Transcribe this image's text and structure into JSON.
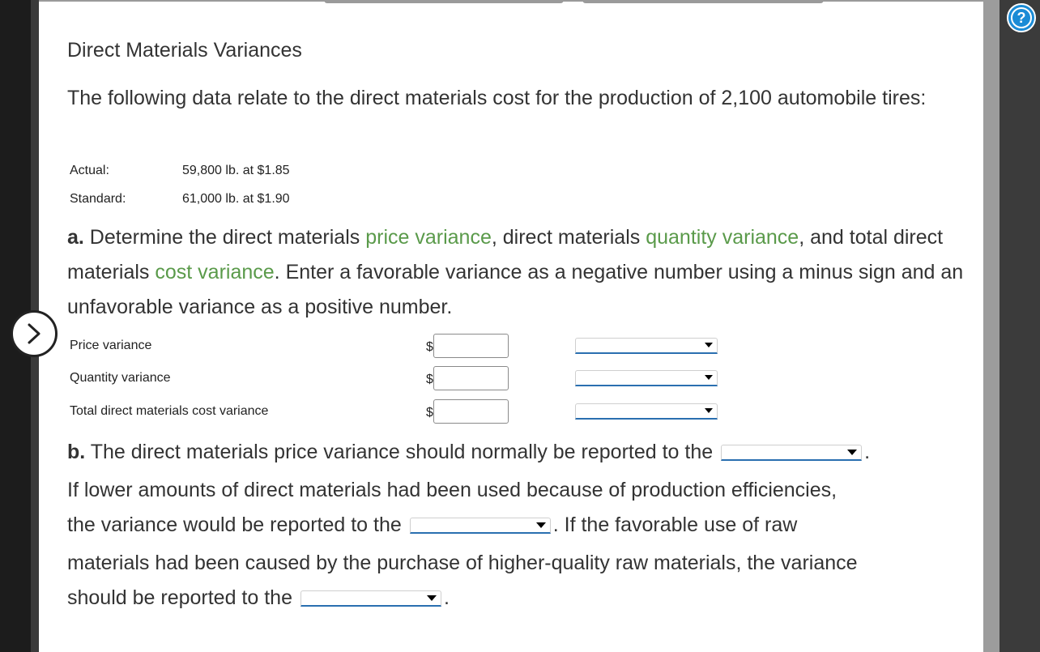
{
  "title": "Direct Materials Variances",
  "intro": "The following data relate to the direct materials cost for the production of 2,100 automobile tires:",
  "given": [
    {
      "label": "Actual:",
      "value": "59,800 lb. at $1.85"
    },
    {
      "label": "Standard:",
      "value": "61,000 lb. at $1.90"
    }
  ],
  "part_a": {
    "marker": "a.",
    "t1": " Determine the direct materials ",
    "link1": "price variance",
    "t2": ", direct materials ",
    "link2": "quantity variance",
    "t3": ", and total direct materials ",
    "link3": "cost variance",
    "t4": ". Enter a favorable variance as a negative number using a minus sign and an unfavorable variance as a positive number."
  },
  "variances": [
    {
      "label": "Price variance",
      "currency": "$",
      "amount": "",
      "selection": ""
    },
    {
      "label": "Quantity variance",
      "currency": "$",
      "amount": "",
      "selection": ""
    },
    {
      "label": "Total direct materials cost variance",
      "currency": "$",
      "amount": "",
      "selection": ""
    }
  ],
  "part_b": {
    "marker": "b.",
    "line1": " The direct materials price variance should normally be reported to the",
    "line1_end": ".",
    "line2": "If lower amounts of direct materials had been used because of production efficiencies,",
    "line3a": "the variance would be reported to the",
    "line3b": ". If the favorable use of raw",
    "line4": "materials had been caused by the purchase of higher-quality raw materials, the variance",
    "line5a": "should be reported to the",
    "line5b": "."
  },
  "icons": {
    "help": "help-icon",
    "next": "chevron-right-icon"
  },
  "colors": {
    "link_green": "#5a9a4a",
    "help_blue": "#1a8bd6",
    "select_underline": "#2a6fb0"
  }
}
